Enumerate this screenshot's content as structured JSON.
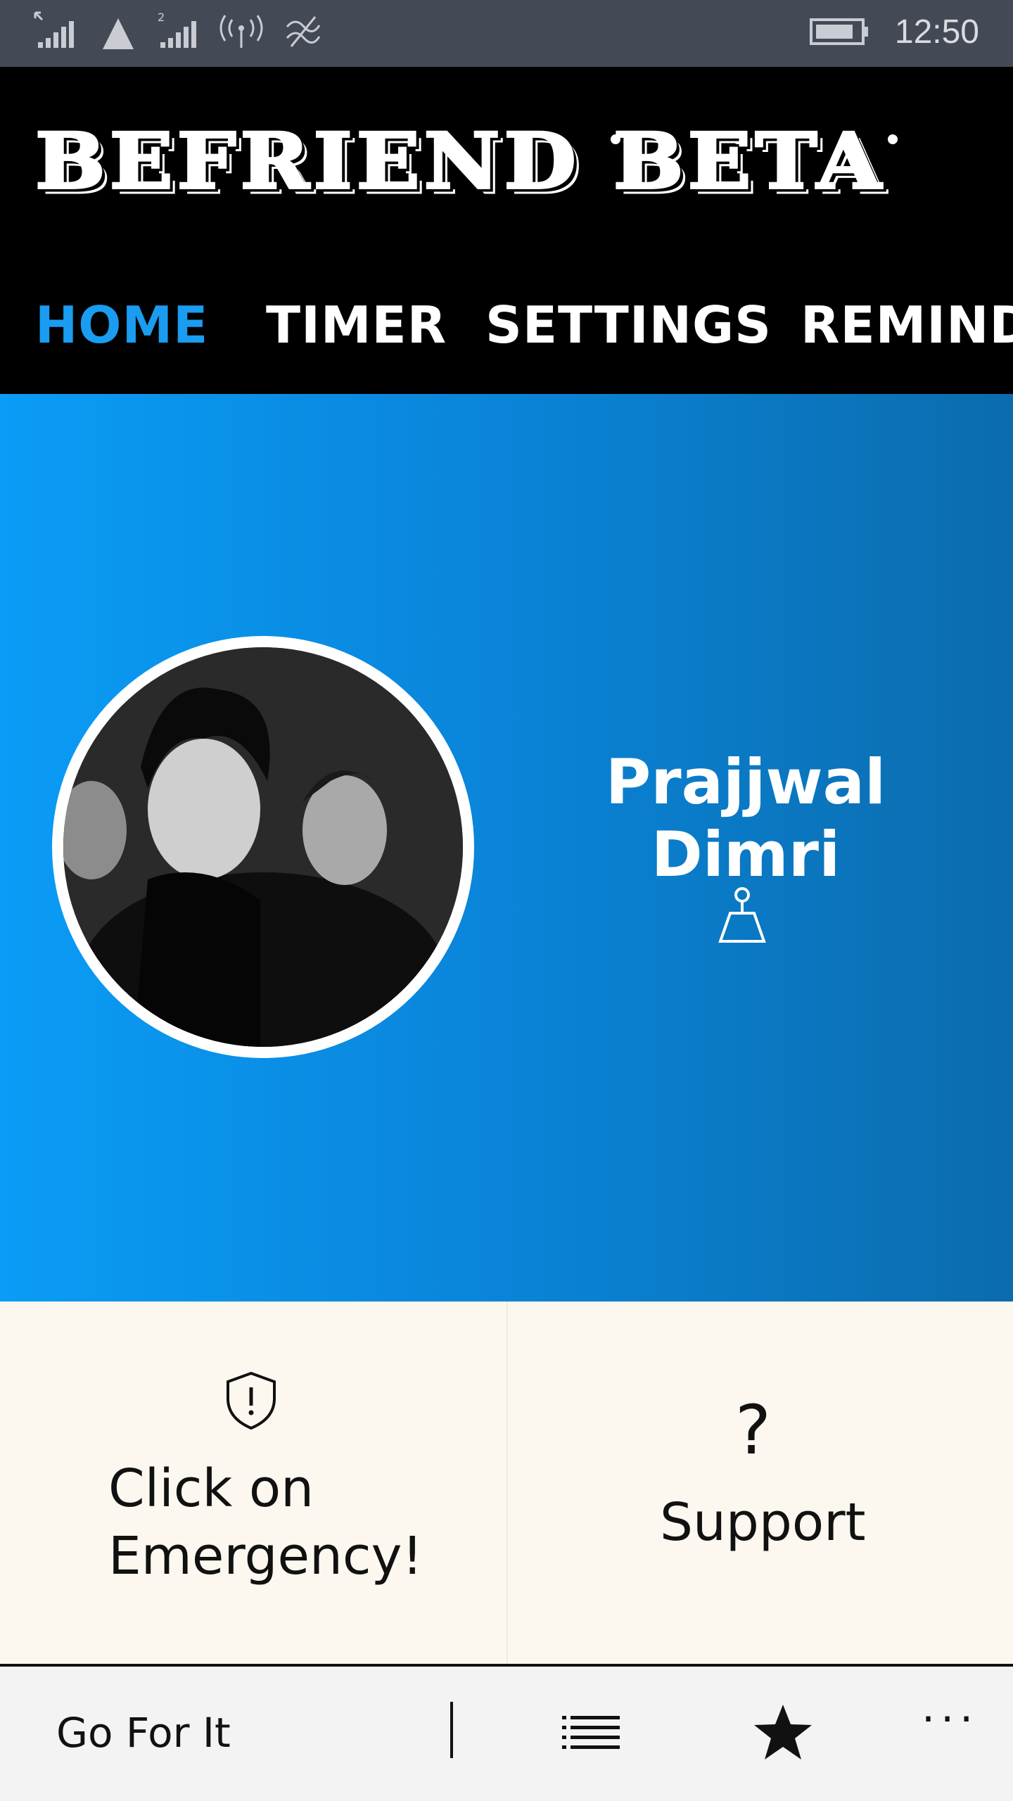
{
  "status_bar": {
    "time": "12:50",
    "icons": [
      "signal-icon",
      "no-sim-icon",
      "signal-2-icon",
      "wifi-hotspot-icon",
      "data-saver-icon",
      "battery-icon"
    ]
  },
  "header": {
    "app_title": "BEFRIEND BETA",
    "tabs": [
      {
        "label": "HOME",
        "active": true
      },
      {
        "label": "TIMER",
        "active": false
      },
      {
        "label": "SETTINGS",
        "active": false
      },
      {
        "label": "REMINDE",
        "active": false
      }
    ],
    "active_color": "#1a9cf0"
  },
  "profile": {
    "name": "Prajjwal Dimri",
    "status_icon": "weight-icon"
  },
  "tiles": {
    "emergency": {
      "icon": "shield-alert-icon",
      "line1": "Click on",
      "line2": "Emergency!"
    },
    "support": {
      "icon": "question-icon",
      "label": "Support",
      "glyph": "?"
    }
  },
  "app_bar": {
    "label": "Go For It",
    "icons": [
      "list-icon",
      "star-icon",
      "more-icon"
    ],
    "more_glyph": "···"
  },
  "colors": {
    "hero_start": "#0a9cf6",
    "hero_end": "#0b6cad",
    "tile_bg": "#fcf8ef",
    "status_bar_bg": "#444a55"
  }
}
